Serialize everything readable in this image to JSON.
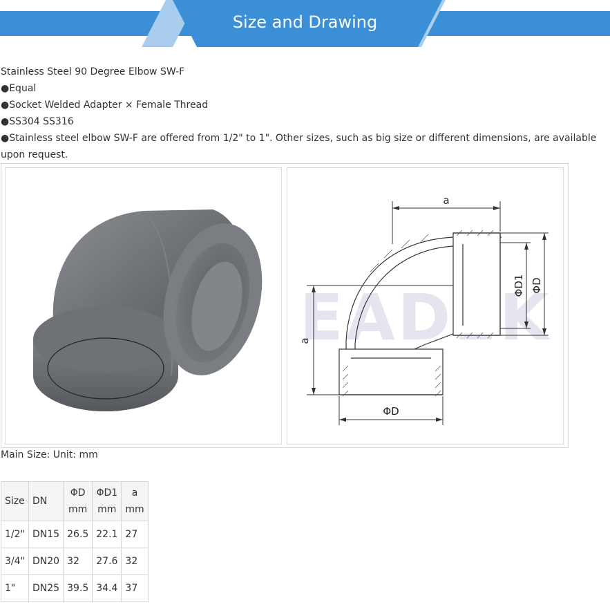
{
  "banner": {
    "title": "Size and Drawing",
    "colors": {
      "bar": "#3b8fd6",
      "band": "#a8cdee",
      "accent": "#3b8fd6"
    }
  },
  "intro": {
    "heading": "Stainless Steel 90 Degree Elbow SW-F",
    "bullets": [
      "●Equal",
      "●Socket Welded Adapter × Female Thread",
      "●SS304 SS316",
      "●Stainless steel elbow SW-F are offered from 1/2\" to 1\". Other sizes, such as big size or different dimensions, are available upon request."
    ]
  },
  "drawing": {
    "watermark": "EADEK",
    "labels": {
      "a_top": "a",
      "a_side": "a",
      "d1": "ΦD1",
      "d_right": "ΦD",
      "d_bottom": "ΦD"
    }
  },
  "main_size": "Main Size:   Unit:  mm",
  "table": {
    "headers": [
      {
        "l1": "Size",
        "l2": ""
      },
      {
        "l1": "DN",
        "l2": ""
      },
      {
        "l1": "ΦD",
        "l2": "mm"
      },
      {
        "l1": "ΦD1",
        "l2": "mm"
      },
      {
        "l1": "a",
        "l2": "mm"
      }
    ],
    "rows": [
      [
        "1/2\"",
        "DN15",
        "26.5",
        "22.1",
        "27"
      ],
      [
        "3/4\"",
        "DN20",
        "32",
        "27.6",
        "32"
      ],
      [
        "1\"",
        "DN25",
        "39.5",
        "34.4",
        "37"
      ]
    ]
  }
}
